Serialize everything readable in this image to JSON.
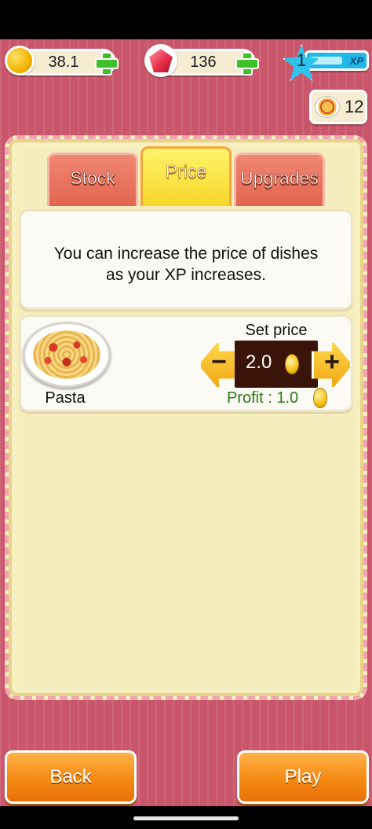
{
  "hud": {
    "coins": "38.1",
    "gems": "136",
    "xp_level": "1",
    "xp_label": "XP",
    "xp_progress": 0.6,
    "dish_count": "12"
  },
  "tabs": [
    {
      "label": "Stock",
      "active": false
    },
    {
      "label": "Price",
      "active": true
    },
    {
      "label": "Upgrades",
      "active": false
    }
  ],
  "info": {
    "line1": "You can increase the price of dishes",
    "line2": "as your XP increases."
  },
  "dish": {
    "name": "Pasta",
    "set_price_label": "Set price",
    "price": "2.0",
    "decrease_symbol": "−",
    "increase_symbol": "+",
    "profit_text": "Profit : 1.0"
  },
  "buttons": {
    "back": "Back",
    "play": "Play"
  },
  "colors": {
    "background": "#c9566a",
    "panel": "#f6efbf",
    "tab_active": "#f6d72a",
    "tab_inactive": "#e26550",
    "button": "#f58a12",
    "profit": "#2a7a18"
  }
}
